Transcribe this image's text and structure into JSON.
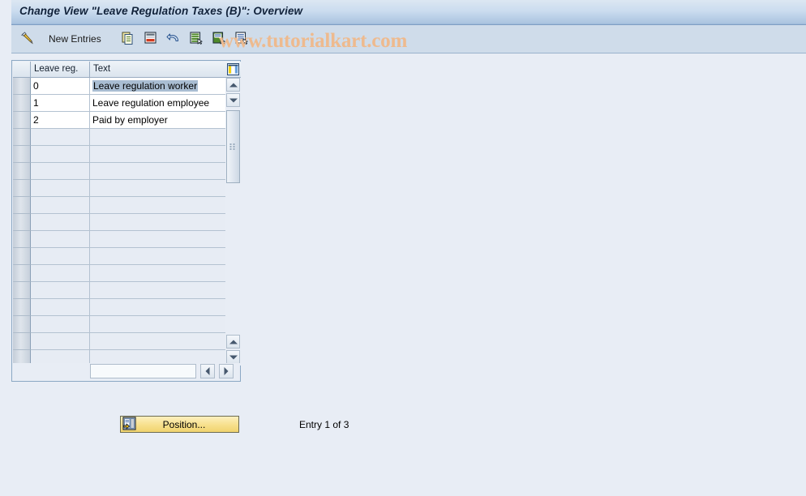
{
  "window": {
    "title": "Change View \"Leave Regulation Taxes (B)\": Overview"
  },
  "toolbar": {
    "items": [
      {
        "name": "display-change-icon",
        "icon": "pencil-icon",
        "label": ""
      },
      {
        "name": "new-entries-button",
        "icon": "",
        "label": "New Entries"
      },
      {
        "name": "copy-as-button",
        "icon": "copy-icon",
        "label": ""
      },
      {
        "name": "delete-button",
        "icon": "delete-row-icon",
        "label": ""
      },
      {
        "name": "undo-button",
        "icon": "undo-arrow-icon",
        "label": ""
      },
      {
        "name": "select-all-button",
        "icon": "select-all-icon",
        "label": ""
      },
      {
        "name": "deselect-all-button",
        "icon": "deselect-all-icon",
        "label": ""
      },
      {
        "name": "details-button",
        "icon": "details-icon",
        "label": ""
      }
    ]
  },
  "watermark": {
    "text": "www.tutorialkart.com",
    "color": "#eeba8e"
  },
  "table": {
    "columns": [
      {
        "key": "leave_reg",
        "label": "Leave reg."
      },
      {
        "key": "text",
        "label": "Text"
      }
    ],
    "config_icon": "table-settings-icon",
    "rows": [
      {
        "leave_reg": "0",
        "text": "Leave regulation worker",
        "selected": true
      },
      {
        "leave_reg": "1",
        "text": "Leave regulation employee",
        "selected": false
      },
      {
        "leave_reg": "2",
        "text": "Paid by employer",
        "selected": false
      }
    ],
    "empty_row_count": 14
  },
  "scrollbars": {
    "vertical": {
      "up_icon": "scroll-up-icon",
      "down_icon": "scroll-down-icon",
      "page_up_icon": "page-up-icon",
      "page_down_icon": "page-down-icon"
    },
    "horizontal": {
      "left_icon": "scroll-left-icon",
      "right_icon": "scroll-right-icon"
    }
  },
  "footer": {
    "position_button": {
      "label": "Position...",
      "icon": "position-icon"
    },
    "entry_status": "Entry 1 of 3"
  }
}
